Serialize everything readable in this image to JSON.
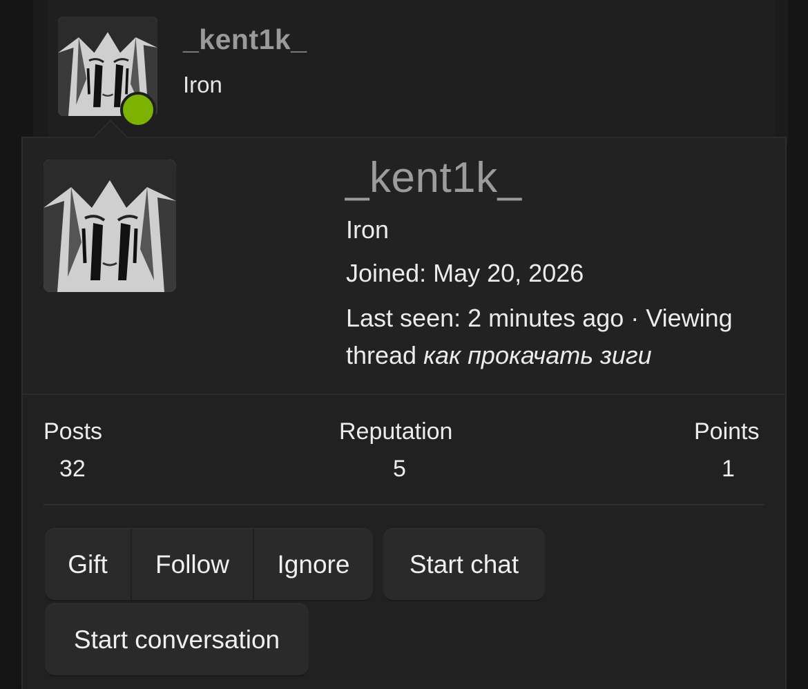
{
  "thread_post": {
    "username": "_kent1k_",
    "rank": "Iron",
    "online_status_color": "#7bb300"
  },
  "member_card": {
    "username": "_kent1k_",
    "rank": "Iron",
    "joined_label": "Joined:",
    "joined_date": "May 20, 2026",
    "last_seen_label": "Last seen:",
    "last_seen_value": "2 minutes ago · Viewing",
    "activity_prefix": "thread",
    "activity_thread": "как прокачать зиги"
  },
  "stats": [
    {
      "label": "Posts",
      "value": "32"
    },
    {
      "label": "Reputation",
      "value": "5"
    },
    {
      "label": "Points",
      "value": "1"
    }
  ],
  "actions": {
    "gift": "Gift",
    "follow": "Follow",
    "ignore": "Ignore",
    "start_chat": "Start chat",
    "start_conversation": "Start conversation"
  },
  "colors": {
    "background": "#151515",
    "card": "#212121",
    "username": "#9c9c9c",
    "button": "#2a2a2a",
    "online": "#7bb300"
  },
  "icons": {
    "avatar": "user-avatar-image",
    "online_indicator": "online-dot-icon"
  }
}
